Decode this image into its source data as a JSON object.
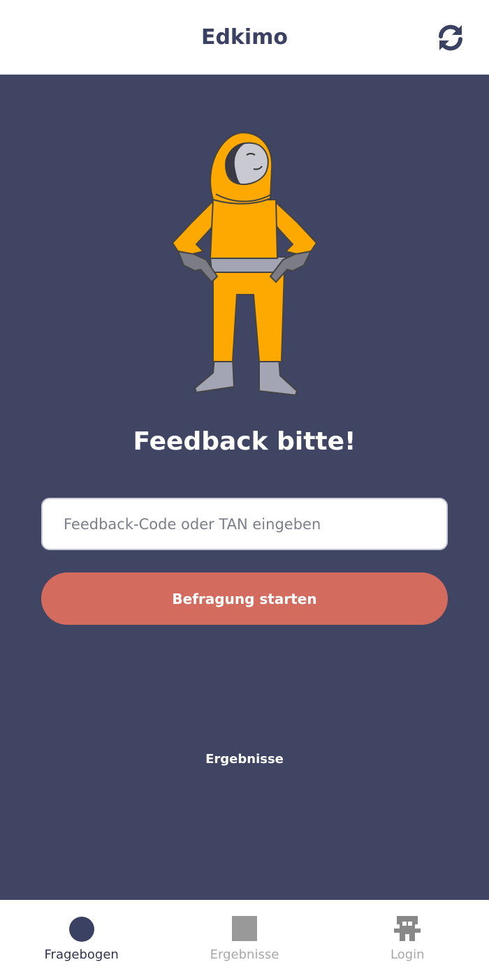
{
  "app": {
    "title": "Edkimo",
    "refresh_icon": "refresh-icon"
  },
  "main": {
    "heading": "Feedback bitte!",
    "code_input": {
      "value": "",
      "placeholder": "Feedback-Code oder TAN eingeben"
    },
    "start_button_label": "Befragung starten",
    "results_link_label": "Ergebnisse",
    "illustration": "astronaut-illustration"
  },
  "bottom_nav": {
    "items": [
      {
        "label": "Fragebogen",
        "icon": "circle-icon",
        "active": true
      },
      {
        "label": "Ergebnisse",
        "icon": "square-icon",
        "active": false
      },
      {
        "label": "Login",
        "icon": "login-icon",
        "active": false
      }
    ]
  },
  "colors": {
    "primary": "#3f4563",
    "accent_button": "#d36b5f",
    "suit": "#fda901",
    "inactive": "#a8a8a8"
  }
}
